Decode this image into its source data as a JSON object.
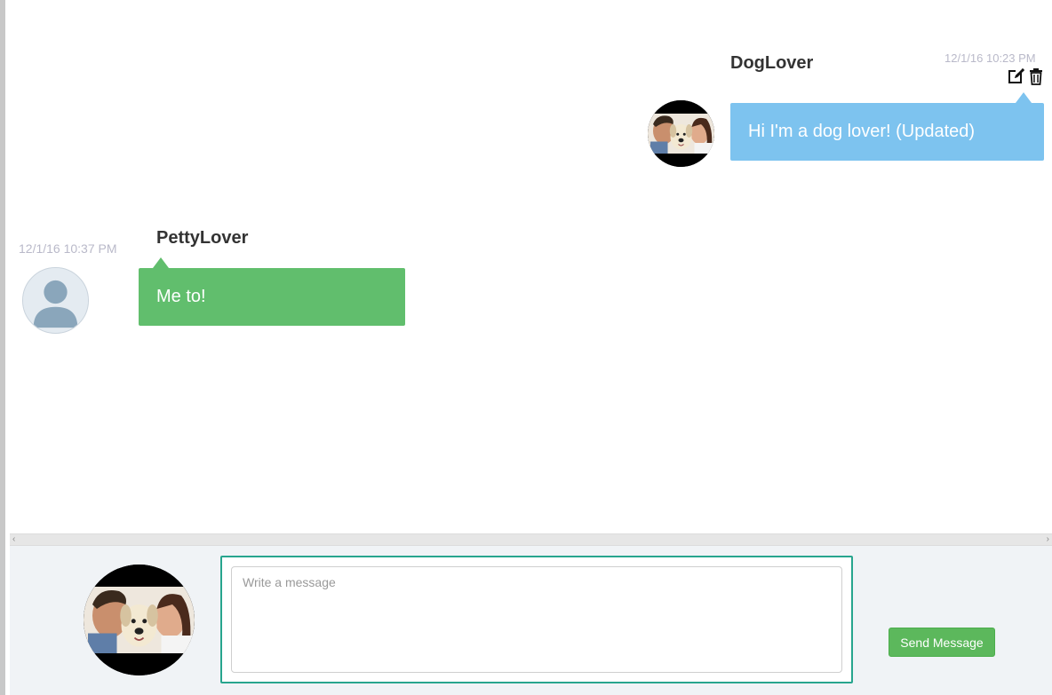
{
  "messages": [
    {
      "username": "DogLover",
      "timestamp": "12/1/16 10:23 PM",
      "text": "Hi I'm a dog lover! (Updated)",
      "side": "right",
      "bubble_color": "#7dc3ef",
      "avatar": "couple-with-dog-photo",
      "actions": [
        "edit-icon",
        "trash-icon"
      ]
    },
    {
      "username": "PettyLover",
      "timestamp": "12/1/16 10:37 PM",
      "text": "Me to!",
      "side": "left",
      "bubble_color": "#61be6d",
      "avatar": "default-user-icon"
    }
  ],
  "composer": {
    "placeholder": "Write a message",
    "value": "",
    "send_label": "Send Message",
    "avatar": "couple-with-dog-photo",
    "border_color": "#27a58e"
  },
  "colors": {
    "send_button": "#5cb85c",
    "timestamp": "#b9b9c9",
    "composer_bg": "#f0f3f6"
  }
}
